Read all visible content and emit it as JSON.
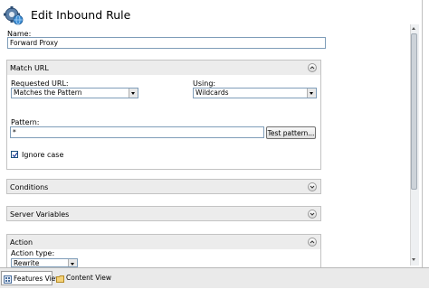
{
  "header": {
    "title": "Edit Inbound Rule",
    "icon": "iis-gear-globe-icon"
  },
  "name_field": {
    "label": "Name:",
    "value": "Forward Proxy"
  },
  "match_url": {
    "title": "Match URL",
    "requested_url_label": "Requested URL:",
    "requested_url_value": "Matches the Pattern",
    "using_label": "Using:",
    "using_value": "Wildcards",
    "pattern_label": "Pattern:",
    "pattern_value": "*",
    "test_pattern_button": "Test pattern...",
    "ignore_case_label": "Ignore case",
    "ignore_case_checked": true
  },
  "conditions": {
    "title": "Conditions"
  },
  "server_variables": {
    "title": "Server Variables"
  },
  "action": {
    "title": "Action",
    "action_type_label": "Action type:",
    "action_type_value": "Rewrite"
  },
  "bottom_tabs": {
    "features_view": "Features View",
    "content_view": "Content View"
  },
  "colors": {
    "section_header": "#ececec",
    "border": "#c3c3c3",
    "input_border": "#7f9db9"
  }
}
